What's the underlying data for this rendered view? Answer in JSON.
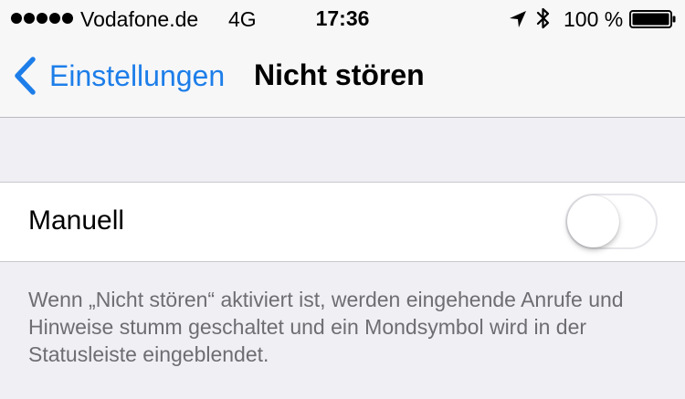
{
  "status_bar": {
    "carrier": "Vodafone.de",
    "network": "4G",
    "time": "17:36",
    "battery_percent": "100 %",
    "signal_bars": 5,
    "battery_level": 1.0
  },
  "nav": {
    "back_label": "Einstellungen",
    "title": "Nicht stören"
  },
  "settings": {
    "manual_label": "Manuell",
    "manual_enabled": false
  },
  "footer": {
    "text": "Wenn „Nicht stören“ aktiviert ist, werden eingehende Anrufe und Hinweise stumm geschaltet und ein Mondsymbol wird in der Statusleiste eingeblendet."
  },
  "colors": {
    "accent": "#1d7ee9",
    "background": "#efeff4",
    "footer_text": "#6d6d72"
  }
}
